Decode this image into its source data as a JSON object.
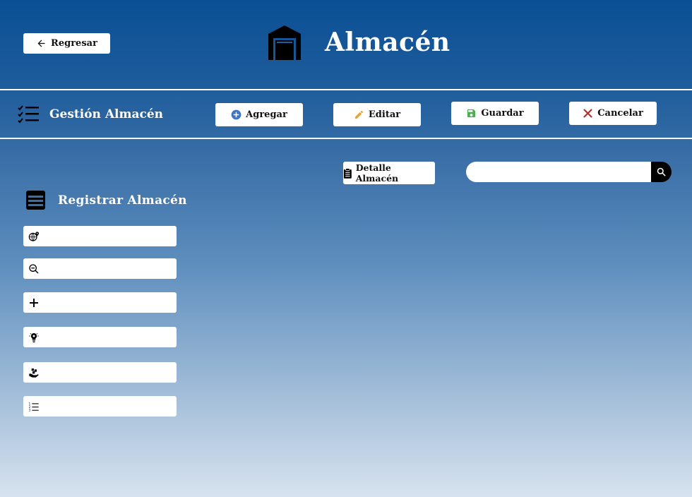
{
  "header": {
    "back_label": "Regresar",
    "title": "Almacén"
  },
  "toolbar": {
    "section_title": "Gestión Almacén",
    "add_label": "Agregar",
    "edit_label": "Editar",
    "save_label": "Guardar",
    "cancel_label": "Cancelar"
  },
  "detail": {
    "label": "Detalle Almacén"
  },
  "search": {
    "value": "",
    "placeholder": ""
  },
  "form": {
    "title": "Registrar Almacén",
    "fields": [
      {
        "icon": "globe-pin-icon",
        "value": "",
        "placeholder": ""
      },
      {
        "icon": "zoom-out-icon",
        "value": "",
        "placeholder": ""
      },
      {
        "icon": "plus-icon",
        "value": "",
        "placeholder": ""
      },
      {
        "icon": "lightbulb-icon",
        "value": "",
        "placeholder": ""
      },
      {
        "icon": "hand-boxes-icon",
        "value": "",
        "placeholder": ""
      },
      {
        "icon": "numbered-list-icon",
        "value": "",
        "placeholder": ""
      }
    ]
  },
  "colors": {
    "add_icon": "#3d76c9",
    "edit_icon": "#f0a030",
    "save_icon": "#4caf50",
    "cancel_icon": "#c62828"
  }
}
